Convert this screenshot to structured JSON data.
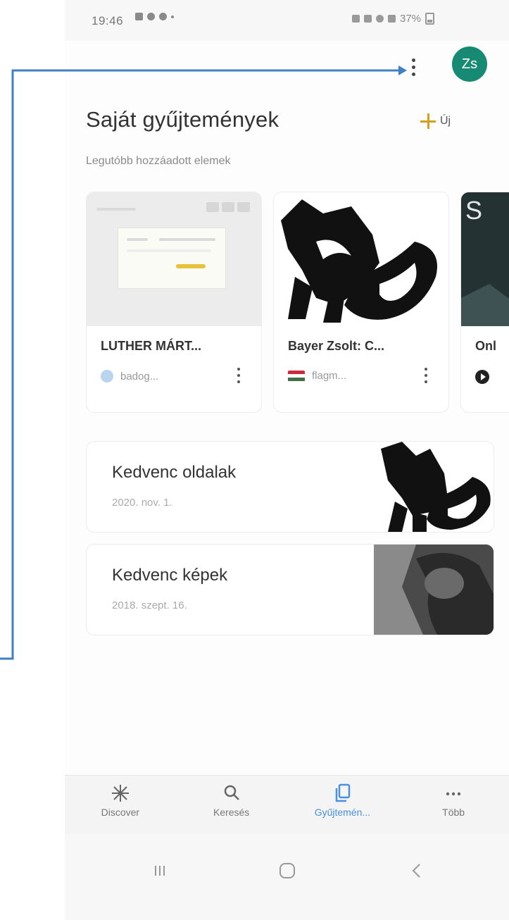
{
  "status_bar": {
    "time": "19:46",
    "battery": "37%"
  },
  "header": {
    "avatar_initials": "Zs",
    "title": "Saját gyűjtemények",
    "subtitle": "Legutóbb hozzáadott elemek",
    "new_label": "Új"
  },
  "recent_items": [
    {
      "title": "LUTHER MÁRT...",
      "source": "badog..."
    },
    {
      "title": "Bayer Zsolt: C...",
      "source": "flagm..."
    },
    {
      "title": "Onl",
      "source": ""
    }
  ],
  "collections": [
    {
      "title": "Kedvenc oldalak",
      "date": "2020. nov. 1."
    },
    {
      "title": "Kedvenc képek",
      "date": "2018. szept. 16."
    }
  ],
  "bottom_nav": [
    {
      "label": "Discover",
      "icon": "sparkle-icon"
    },
    {
      "label": "Keresés",
      "icon": "search-icon"
    },
    {
      "label": "Gyűjtemén...",
      "icon": "collections-icon",
      "active": true
    },
    {
      "label": "Több",
      "icon": "more-horiz-icon"
    }
  ],
  "colors": {
    "avatar": "#178a73",
    "accent_plus": "#d4a017",
    "active_nav": "#4a8fe0",
    "arrow": "#3f7fc6"
  }
}
